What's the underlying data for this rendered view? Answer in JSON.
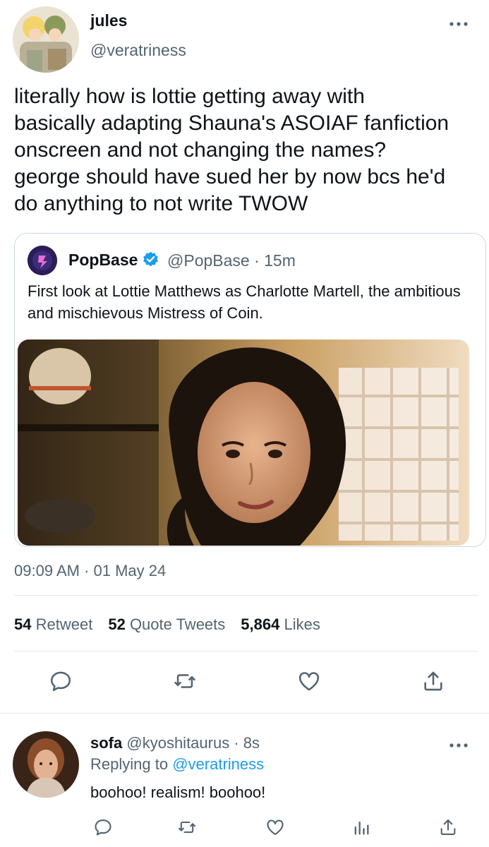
{
  "tweet": {
    "display_name": "jules",
    "handle": "@veratriness",
    "text": "literally how is lottie getting away with\nbasically adapting Shauna's ASOIAF fanfiction\nonscreen and not changing the names?\ngeorge should have sued her by now bcs he'd\ndo anything to not write TWOW",
    "timestamp": "09:09 AM · 01 May 24",
    "stats": {
      "retweets_count": "54",
      "retweets_label": "Retweet",
      "quotes_count": "52",
      "quotes_label": "Quote Tweets",
      "likes_count": "5,864",
      "likes_label": "Likes"
    },
    "actions": [
      "reply-icon",
      "retweet-icon",
      "like-icon",
      "share-icon"
    ]
  },
  "quoted_tweet": {
    "display_name": "PopBase",
    "verified": true,
    "handle_time": "@PopBase · 15m",
    "text": "First look at Lottie Matthews as Charlotte Martell, the ambitious and mischievous Mistress of Coin."
  },
  "reply": {
    "display_name": "sofa",
    "handle_time": "@kyoshitaurus · 8s",
    "replying_prefix": "Replying to",
    "replying_to": "@veratriness",
    "text": "boohoo! realism! boohoo!",
    "actions": [
      "reply-icon",
      "retweet-icon",
      "like-icon",
      "analytics-icon",
      "share-icon"
    ]
  },
  "colors": {
    "text": "#0f1419",
    "secondary": "#536471",
    "link": "#1d9bf0",
    "border": "#cfd9de"
  }
}
